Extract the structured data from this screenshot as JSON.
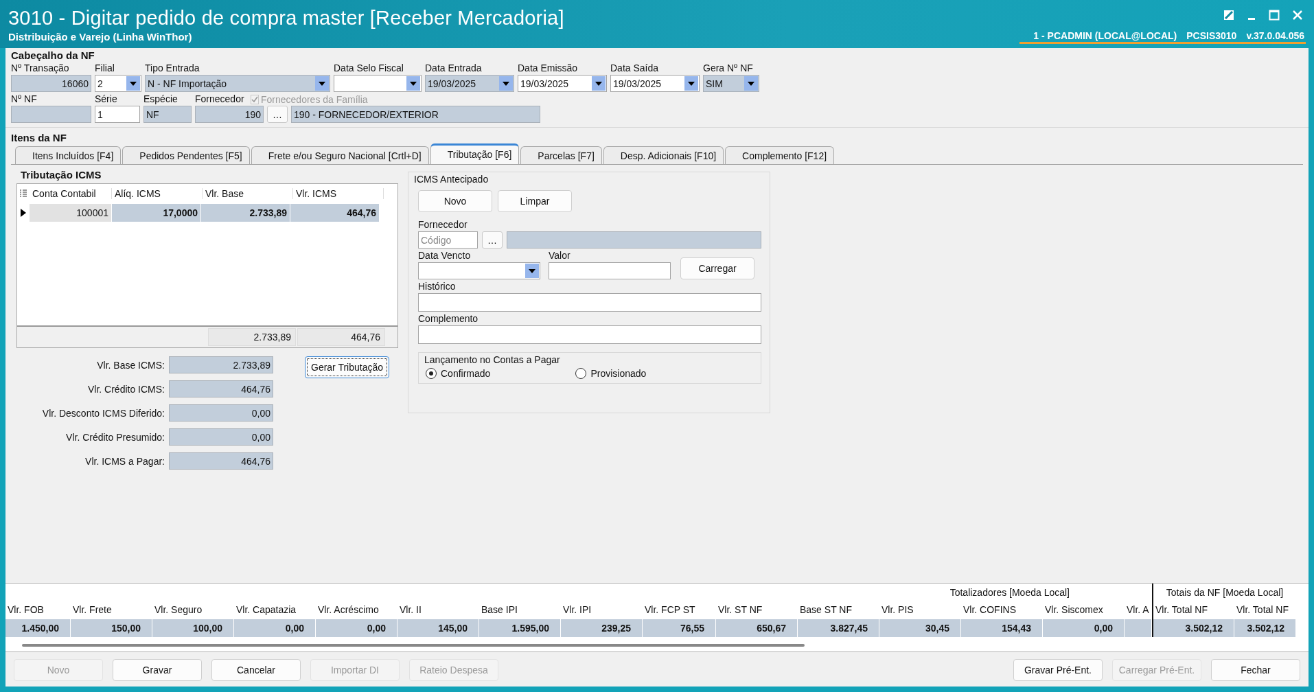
{
  "window": {
    "title": "3010 - Digitar pedido de compra master [Receber Mercadoria]",
    "subtitle": "Distribuição e Varejo (Linha WinThor)",
    "user": "1 - PCADMIN (LOCAL@LOCAL)",
    "program": "PCSIS3010",
    "version": "v.37.0.04.056"
  },
  "header": {
    "title": "Cabeçalho da NF",
    "row_1": [
      {
        "label": "Nº Transação",
        "value": "16060",
        "kind": "number"
      },
      {
        "label": "Filial",
        "value": "2",
        "kind": "combo"
      },
      {
        "label": "Tipo Entrada",
        "value": "N - NF Importação",
        "kind": "combo-readonly"
      },
      {
        "label": "Data Selo Fiscal",
        "kind": "combo"
      },
      {
        "label": "Data Entrada",
        "value": "19/03/2025",
        "kind": "combo-readonly"
      },
      {
        "label": "Data Emissão",
        "value": "19/03/2025",
        "kind": "combo"
      },
      {
        "label": "Data Saída",
        "value": "19/03/2025",
        "kind": "combo"
      },
      {
        "label": "Gera Nº NF",
        "value": "SIM",
        "kind": "combo-readonly"
      }
    ],
    "row_2": [
      {
        "label": "Nº NF",
        "kind": "readonly"
      },
      {
        "label": "Série",
        "value": "1",
        "kind": "input"
      },
      {
        "label": "Espécie",
        "value": "NF",
        "kind": "readonly"
      },
      {
        "label": "Fornecedor",
        "value": "190",
        "kind": "number"
      },
      {
        "value": "…",
        "kind": "button"
      },
      {
        "value": "190 - FORNECEDOR/EXTERIOR",
        "kind": "readonly"
      }
    ],
    "supplier_family": {
      "label": "Fornecedores da Família",
      "checked": true,
      "disabled": true
    }
  },
  "items_title": "Itens da NF",
  "tabs": [
    {
      "label": "Itens Incluídos [F4]",
      "selected": false
    },
    {
      "label": "Pedidos Pendentes [F5]",
      "selected": false
    },
    {
      "label": "Frete e/ou Seguro Nacional [Crtl+D]",
      "selected": false
    },
    {
      "label": "Tributação [F6]",
      "selected": true
    },
    {
      "label": "Parcelas [F7]",
      "selected": false
    },
    {
      "label": "Desp. Adicionais [F10]",
      "selected": false
    },
    {
      "label": "Complemento [F12]",
      "selected": false
    }
  ],
  "icms": {
    "title": "Tributação ICMS",
    "columns": [
      "Conta Contabil",
      "Alíq. ICMS",
      "Vlr. Base",
      "Vlr. ICMS"
    ],
    "rows": [
      {
        "cells": [
          "100001",
          "17,0000",
          "2.733,89",
          "464,76"
        ],
        "selected": true
      }
    ],
    "footer": [
      "2.733,89",
      "464,76"
    ],
    "summary": [
      {
        "label": "Vlr. Base ICMS:",
        "value": "2.733,89"
      },
      {
        "label": "Vlr. Crédito ICMS:",
        "value": "464,76"
      },
      {
        "label": "Vlr. Desconto ICMS Diferido:",
        "value": "0,00"
      },
      {
        "label": "Vlr. Crédito Presumido:",
        "value": "0,00"
      },
      {
        "label": "Vlr. ICMS a Pagar:",
        "value": "464,76"
      }
    ],
    "generate_button": {
      "label": "Gerar Tributação",
      "focused": true
    }
  },
  "antecipado": {
    "title": "ICMS Antecipado",
    "buttons": [
      "Novo",
      "Limpar"
    ],
    "supplier_label": "Fornecedor",
    "code_placeholder": "Código",
    "lookup": "…",
    "due_label": "Data Vencto",
    "value_label": "Valor",
    "load_button": "Carregar",
    "history_label": "Histórico",
    "complement_label": "Complemento",
    "posting": {
      "title": "Lançamento no Contas a Pagar",
      "options": [
        {
          "label": "Confirmado",
          "selected": true
        },
        {
          "label": "Provisionado",
          "selected": false
        }
      ]
    }
  },
  "totals": {
    "title": "Totalizadores [Moeda Local]",
    "columns": [
      {
        "label": "Vlr. FOB",
        "value": "1.450,00"
      },
      {
        "label": "Vlr. Frete",
        "value": "150,00"
      },
      {
        "label": "Vlr. Seguro",
        "value": "100,00"
      },
      {
        "label": "Vlr. Capatazia",
        "value": "0,00"
      },
      {
        "label": "Vlr. Acréscimo",
        "value": "0,00"
      },
      {
        "label": "Vlr. II",
        "value": "145,00"
      },
      {
        "label": "Base IPI",
        "value": "1.595,00"
      },
      {
        "label": "Vlr. IPI",
        "value": "239,25"
      },
      {
        "label": "Vlr. FCP ST",
        "value": "76,55"
      },
      {
        "label": "Vlr. ST NF",
        "value": "650,67"
      },
      {
        "label": "Base ST NF",
        "value": "3.827,45"
      },
      {
        "label": "Vlr. PIS",
        "value": "30,45"
      },
      {
        "label": "Vlr. COFINS",
        "value": "154,43"
      },
      {
        "label": "Vlr. Siscomex",
        "value": "0,00"
      },
      {
        "label": "Vlr. A"
      }
    ],
    "nf_title": "Totais da NF [Moeda Local]",
    "nf_columns": [
      {
        "label": "Vlr. Total NF",
        "value": "3.502,12"
      },
      {
        "label": "Vlr. Total NF",
        "value": "3.502,12"
      }
    ]
  },
  "footer_buttons": [
    {
      "label": "Novo",
      "disabled": true
    },
    {
      "label": "Gravar",
      "disabled": false
    },
    {
      "label": "Cancelar",
      "disabled": false
    },
    {
      "label": "Importar DI",
      "disabled": true
    },
    {
      "label": "Rateio Despesa",
      "disabled": true
    }
  ],
  "footer_buttons_right": [
    {
      "label": "Gravar Pré-Ent.",
      "disabled": false
    },
    {
      "label": "Carregar Pré-Ent.",
      "disabled": true
    },
    {
      "label": "Fechar",
      "disabled": false
    }
  ]
}
